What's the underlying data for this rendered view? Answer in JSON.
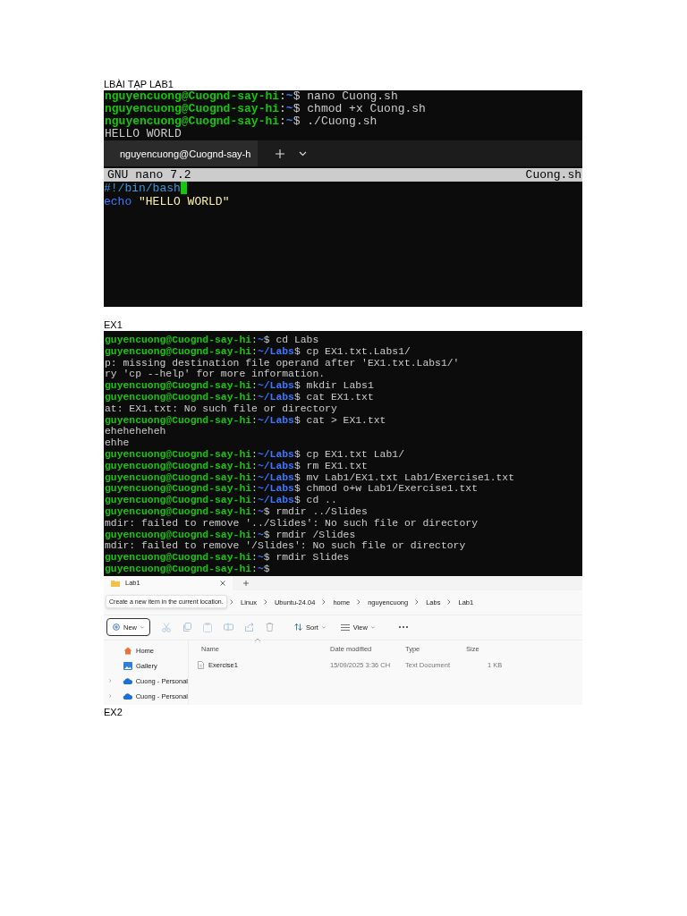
{
  "heading": "LBÀI TẠP LAB1",
  "terminal_1": {
    "lines": [
      {
        "kind": "prompt",
        "user": "nguyencuong@Cuognd-say-hi",
        "colon": ":",
        "path": "~",
        "dollar": "$",
        "command": "nano Cuong.sh"
      },
      {
        "kind": "prompt",
        "user": "nguyencuong@Cuognd-say-hi",
        "colon": ":",
        "path": "~",
        "dollar": "$",
        "command": "chmod +x Cuong.sh"
      },
      {
        "kind": "prompt",
        "user": "nguyencuong@Cuognd-say-hi",
        "colon": ":",
        "path": "~",
        "dollar": "$",
        "command": "./Cuong.sh"
      },
      {
        "kind": "output",
        "text": "HELLO WORLD"
      }
    ]
  },
  "nano": {
    "tab_title": "nguyencuong@Cuognd-say-h",
    "app_title": "GNU nano 7.2",
    "filename": "Cuong.sh",
    "lines": [
      [
        {
          "kind": "comment",
          "text": "#!/bin/bash"
        },
        {
          "kind": "cursor"
        }
      ],
      [
        {
          "kind": "keyword",
          "text": "echo"
        },
        {
          "kind": "string",
          "text": "\"HELLO WORLD\""
        }
      ]
    ]
  },
  "section_1": "EX1",
  "terminal_2": {
    "lines": [
      {
        "kind": "prompt",
        "user": "guyencuong@Cuognd-say-hi",
        "colon": ":",
        "path": "~",
        "dollar": "$",
        "command": "cd Labs"
      },
      {
        "kind": "prompt",
        "user": "guyencuong@Cuognd-say-hi",
        "colon": ":",
        "path": "~/Labs",
        "dollar": "$",
        "command": "cp EX1.txt.Labs1/"
      },
      {
        "kind": "output",
        "text": "p: missing destination file operand after 'EX1.txt.Labs1/'"
      },
      {
        "kind": "output",
        "text": "ry 'cp --help' for more information."
      },
      {
        "kind": "prompt",
        "user": "guyencuong@Cuognd-say-hi",
        "colon": ":",
        "path": "~/Labs",
        "dollar": "$",
        "command": "mkdir Labs1"
      },
      {
        "kind": "prompt",
        "user": "guyencuong@Cuognd-say-hi",
        "colon": ":",
        "path": "~/Labs",
        "dollar": "$",
        "command": "cat EX1.txt"
      },
      {
        "kind": "output",
        "text": "at: EX1.txt: No such file or directory"
      },
      {
        "kind": "prompt",
        "user": "guyencuong@Cuognd-say-hi",
        "colon": ":",
        "path": "~/Labs",
        "dollar": "$",
        "command": "cat > EX1.txt"
      },
      {
        "kind": "output",
        "text": "eheheheheh"
      },
      {
        "kind": "output",
        "text": "ehhe"
      },
      {
        "kind": "prompt",
        "user": "guyencuong@Cuognd-say-hi",
        "colon": ":",
        "path": "~/Labs",
        "dollar": "$",
        "command": "cp EX1.txt Lab1/"
      },
      {
        "kind": "prompt",
        "user": "guyencuong@Cuognd-say-hi",
        "colon": ":",
        "path": "~/Labs",
        "dollar": "$",
        "command": "rm EX1.txt"
      },
      {
        "kind": "prompt",
        "user": "guyencuong@Cuognd-say-hi",
        "colon": ":",
        "path": "~/Labs",
        "dollar": "$",
        "command": "mv Lab1/EX1.txt Lab1/Exercise1.txt"
      },
      {
        "kind": "prompt",
        "user": "guyencuong@Cuognd-say-hi",
        "colon": ":",
        "path": "~/Labs",
        "dollar": "$",
        "command": "chmod o+w Lab1/Exercise1.txt"
      },
      {
        "kind": "prompt",
        "user": "guyencuong@Cuognd-say-hi",
        "colon": ":",
        "path": "~/Labs",
        "dollar": "$",
        "command": "cd .."
      },
      {
        "kind": "prompt",
        "user": "guyencuong@Cuognd-say-hi",
        "colon": ":",
        "path": "~",
        "dollar": "$",
        "command": "rmdir ../Slides"
      },
      {
        "kind": "output",
        "text": "mdir: failed to remove '../Slides': No such file or directory"
      },
      {
        "kind": "prompt",
        "user": "guyencuong@Cuognd-say-hi",
        "colon": ":",
        "path": "~",
        "dollar": "$",
        "command": "rmdir /Slides"
      },
      {
        "kind": "output",
        "text": "mdir: failed to remove '/Slides': No such file or directory"
      },
      {
        "kind": "prompt",
        "user": "guyencuong@Cuognd-say-hi",
        "colon": ":",
        "path": "~",
        "dollar": "$",
        "command": "rmdir Slides"
      },
      {
        "kind": "prompt",
        "user": "guyencuong@Cuognd-say-hi",
        "colon": ":",
        "path": "~",
        "dollar": "$"
      }
    ]
  },
  "explorer": {
    "tab_title": "Lab1",
    "tooltip": "Create a new item in the current location.",
    "breadcrumbs": [
      "Linux",
      "Ubuntu-24.04",
      "home",
      "nguyencuong",
      "Labs",
      "Lab1"
    ],
    "toolbar": [
      {
        "kind": "new",
        "label": "New"
      },
      {
        "kind": "cut"
      },
      {
        "kind": "copy"
      },
      {
        "kind": "paste"
      },
      {
        "kind": "rename"
      },
      {
        "kind": "share"
      },
      {
        "kind": "delete"
      },
      {
        "kind": "sort",
        "label": "Sort"
      },
      {
        "kind": "view",
        "label": "View"
      },
      {
        "kind": "more"
      }
    ],
    "sidebar": [
      {
        "kind": "home",
        "label": "Home",
        "expandable": false
      },
      {
        "kind": "gallery",
        "label": "Gallery",
        "expandable": false
      },
      {
        "kind": "cloud",
        "label": "Cuong - Personal",
        "expandable": true
      },
      {
        "kind": "cloud",
        "label": "Cuong - Personal",
        "expandable": true
      }
    ],
    "columns": [
      "Name",
      "Date modified",
      "Type",
      "Size"
    ],
    "rows": [
      {
        "name": "Exercise1",
        "date": "15/09/2025 3:36 CH",
        "type": "Text Document",
        "size": "1 KB"
      }
    ]
  },
  "section_2": "EX2"
}
